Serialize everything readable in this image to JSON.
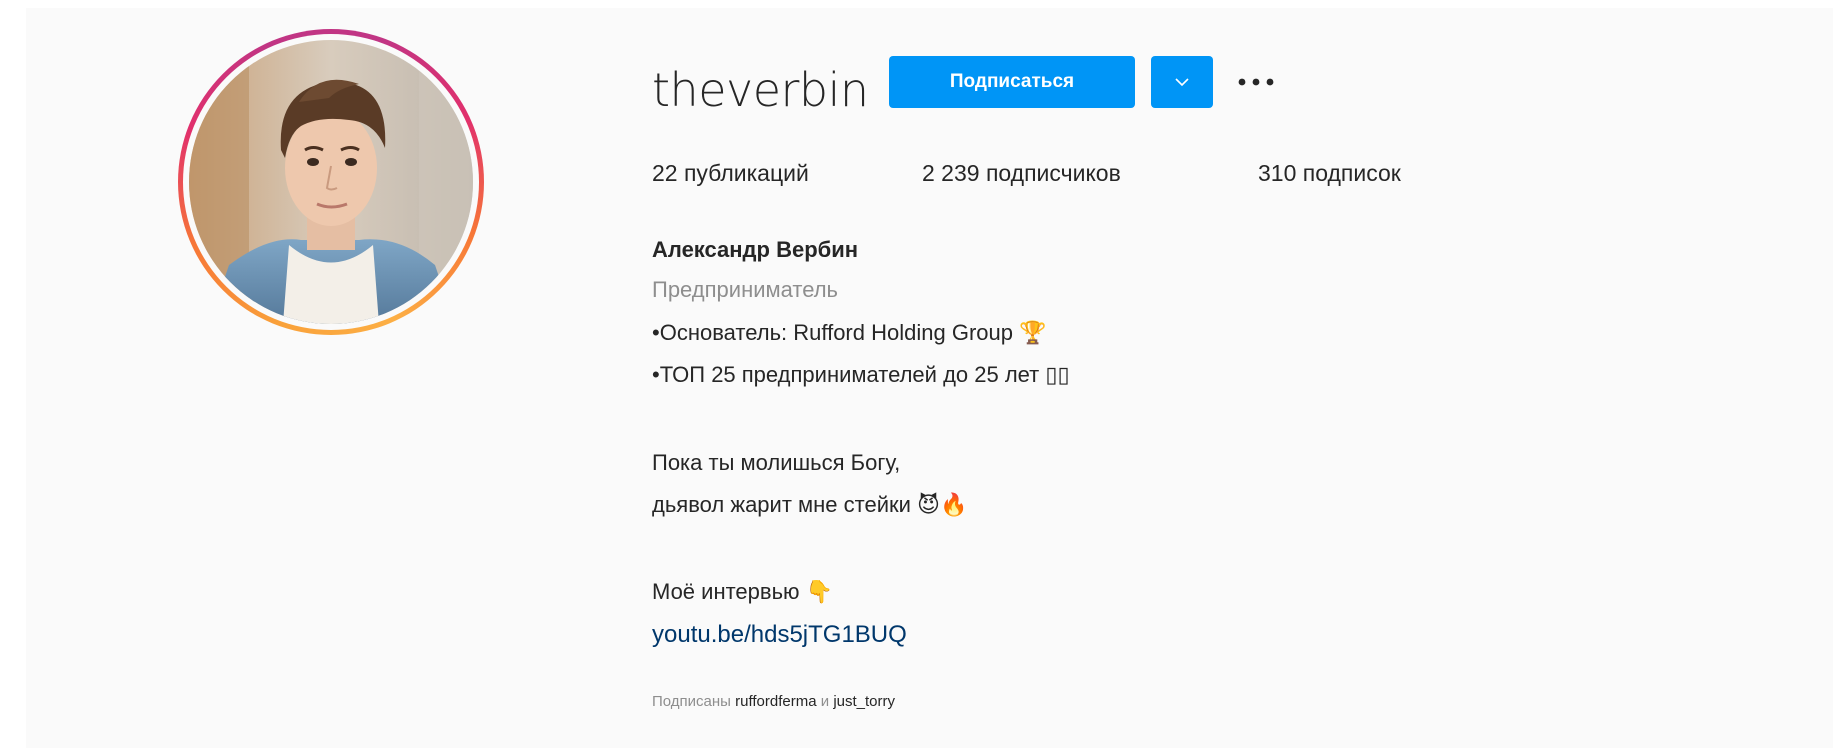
{
  "profile": {
    "username": "theverbin",
    "follow_label": "Подписаться",
    "stats": {
      "posts": "22 публикаций",
      "followers": "2 239 подписчиков",
      "following": "310 подписок"
    },
    "full_name": "Александр Вербин",
    "category": "Предприниматель",
    "bio": {
      "line1": "•Основатель: Rufford Holding Group 🏆",
      "line2": "•ТОП 25 предпринимателей до 25 лет ▯▯",
      "line3": "Пока ты молишься Богу,",
      "line4": "дьявол жарит мне стейки 😈🔥",
      "line5": "Моё интервью 👇"
    },
    "link": "youtu.be/hds5jTG1BUQ",
    "followed_by": {
      "prefix": "Подписаны",
      "user1": "ruffordferma",
      "conjunction": "и",
      "user2": "just_torry"
    }
  },
  "colors": {
    "primary_button": "#0095f6",
    "link": "#00376b",
    "secondary_text": "#8e8e8e",
    "background": "#fafafa"
  },
  "icons": {
    "dropdown": "chevron-down-icon",
    "more": "more-options-icon"
  }
}
